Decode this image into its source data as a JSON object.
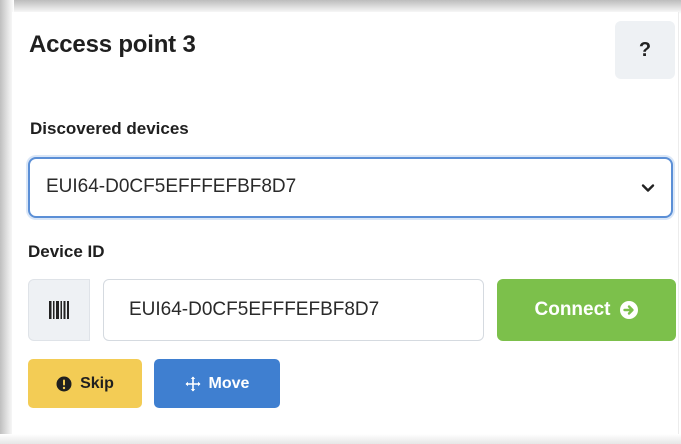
{
  "header": {
    "title": "Access point 3",
    "help_label": "?"
  },
  "discovered": {
    "label": "Discovered devices",
    "selected": "EUI64-D0CF5EFFFEFBF8D7",
    "chevron_icon": "chevron-down-icon"
  },
  "device_id": {
    "label": "Device ID",
    "value": "EUI64-D0CF5EFFFEFBF8D7",
    "barcode_icon": "barcode-icon"
  },
  "actions": {
    "connect_label": "Connect",
    "connect_icon": "arrow-circle-right-icon",
    "skip_label": "Skip",
    "skip_icon": "exclamation-circle-icon",
    "move_label": "Move",
    "move_icon": "move-arrows-icon"
  },
  "colors": {
    "connect": "#7cc04b",
    "skip": "#f3cc55",
    "move": "#3f7fd0",
    "focus_border": "#5b8fd6"
  }
}
